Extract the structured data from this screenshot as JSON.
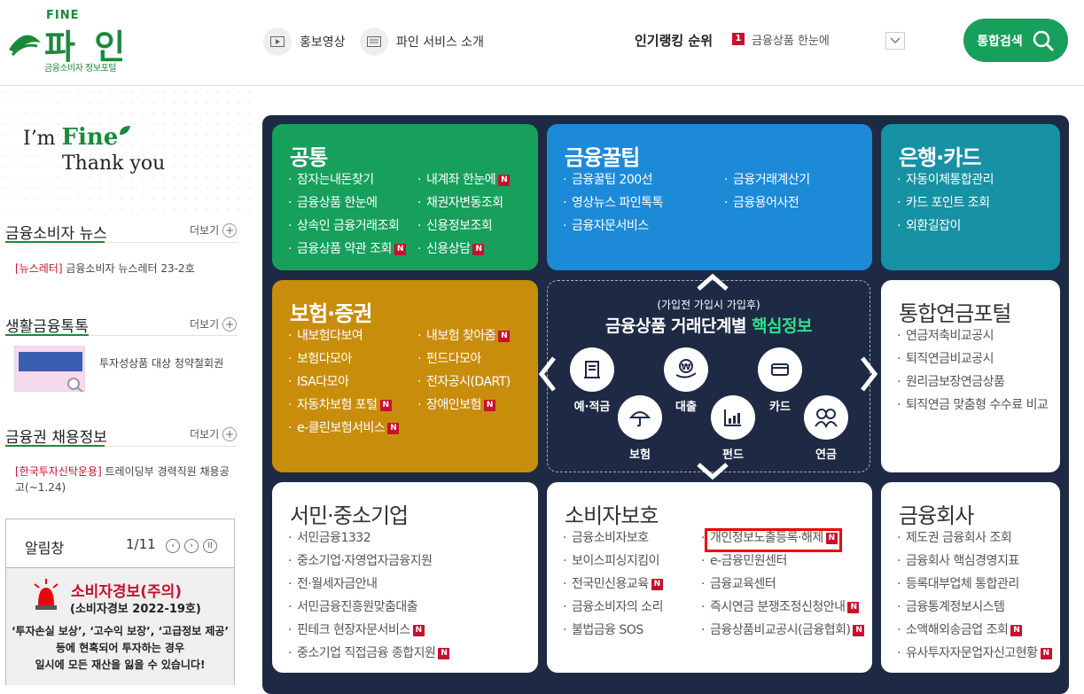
{
  "header": {
    "logo_small": "FINE",
    "logo_brand": "파 인",
    "logo_sub": "금융소비자 정보포털",
    "nav": [
      {
        "label": "홍보영상",
        "icon": "play-icon"
      },
      {
        "label": "파인 서비스 소개",
        "icon": "document-icon"
      }
    ],
    "ranking_label": "인기랭킹 순위",
    "ranking_num": "1",
    "ranking_text": "금융상품 한눈에",
    "search_label": "통합검색"
  },
  "left": {
    "slogan_1a": "I’m ",
    "slogan_1b": "Fine",
    "slogan_2": "Thank you",
    "news": {
      "title": "금융소비자 뉴스",
      "more": "더보기",
      "tag": "[뉴스레터]",
      "text": " 금융소비자 뉴스레터 23-2호"
    },
    "life": {
      "title": "생활금융톡톡",
      "more": "더보기",
      "text": "투자성상품 대상 청약철회권"
    },
    "jobs": {
      "title": "금융권 채용정보",
      "more": "더보기",
      "tag": "[한국투자신탁운용]",
      "text": " 트레이딩부 경력직원 채용공고(~1.24)"
    },
    "notice": {
      "title": "알림창",
      "page": "1/11",
      "alert": "소비자경보(주의)",
      "alert_sub": "(소비자경보 2022-19호)",
      "desc1": "‘투자손실 보상’, ‘고수익 보장’, ‘고급정보 제공’",
      "desc2": "등에 현혹되어 투자하는 경우",
      "desc3": "일시에 모든 재산을 잃을 수 있습니다!"
    }
  },
  "cards": {
    "common": {
      "title": "공통",
      "col1": [
        "잠자는내돈찾기",
        "금융상품 한눈에",
        "상속인 금융거래조회",
        "금융상품 약관 조회"
      ],
      "col2": [
        "내계좌 한눈에",
        "채권자변동조회",
        "신용정보조회",
        "신용상담"
      ]
    },
    "tips": {
      "title": "금융꿀팁",
      "col1": [
        "금융꿀팁 200선",
        "영상뉴스 파인톡톡",
        "금융자문서비스"
      ],
      "col2": [
        "금융거래계산기",
        "금융용어사전"
      ]
    },
    "bank": {
      "title": "은행·카드",
      "col1": [
        "자동이체통합관리",
        "카드 포인트 조회",
        "외환길잡이"
      ]
    },
    "insure": {
      "title": "보험·증권",
      "col1": [
        "내보험다보여",
        "보험다모아",
        "ISA다모아",
        "자동차보험 포털",
        "e-클린보험서비스"
      ],
      "col2": [
        "내보험 찾아줌",
        "펀드다모아",
        "전자공시(DART)",
        "장애인보험"
      ]
    },
    "pension": {
      "title": "통합연금포털",
      "col1": [
        "연금저축비교공시",
        "퇴직연금비교공시",
        "원리금보장연금상품",
        "퇴직연금 맞춤형 수수료 비교"
      ]
    },
    "smb": {
      "title": "서민·중소기업",
      "col1": [
        "서민금융1332",
        "중소기업·자영업자금융지원",
        "전·월세자금안내",
        "서민금융진흥원맞춤대출",
        "핀테크 현장자문서비스",
        "중소기업 직접금융 종합지원"
      ]
    },
    "consumer": {
      "title": "소비자보호",
      "col1": [
        "금융소비자보호",
        "보이스피싱지킴이",
        "전국민신용교육",
        "금융소비자의 소리",
        "불법금융 SOS"
      ],
      "col2": [
        "개인정보노출등록·해제",
        "e-금융민원센터",
        "금융교육센터",
        "즉시연금 분쟁조정신청안내",
        "금융상품비교공시(금융협회)"
      ]
    },
    "company": {
      "title": "금융회사",
      "col1": [
        "제도권 금융회사 조회",
        "금융회사 핵심경영지표",
        "등록대부업체 통합관리",
        "금융통계정보시스템",
        "소액해외송금업 조회",
        "유사투자자문업자신고현황"
      ]
    }
  },
  "center": {
    "t1": "(가입전 가입시 가입후)",
    "t2a": "금융상품 거래단계별 ",
    "t2b": "핵심정보",
    "items": {
      "deposit": "예·적금",
      "loan": "대출",
      "card": "카드",
      "insurance": "보험",
      "fund": "펀드",
      "pension": "연금"
    }
  }
}
